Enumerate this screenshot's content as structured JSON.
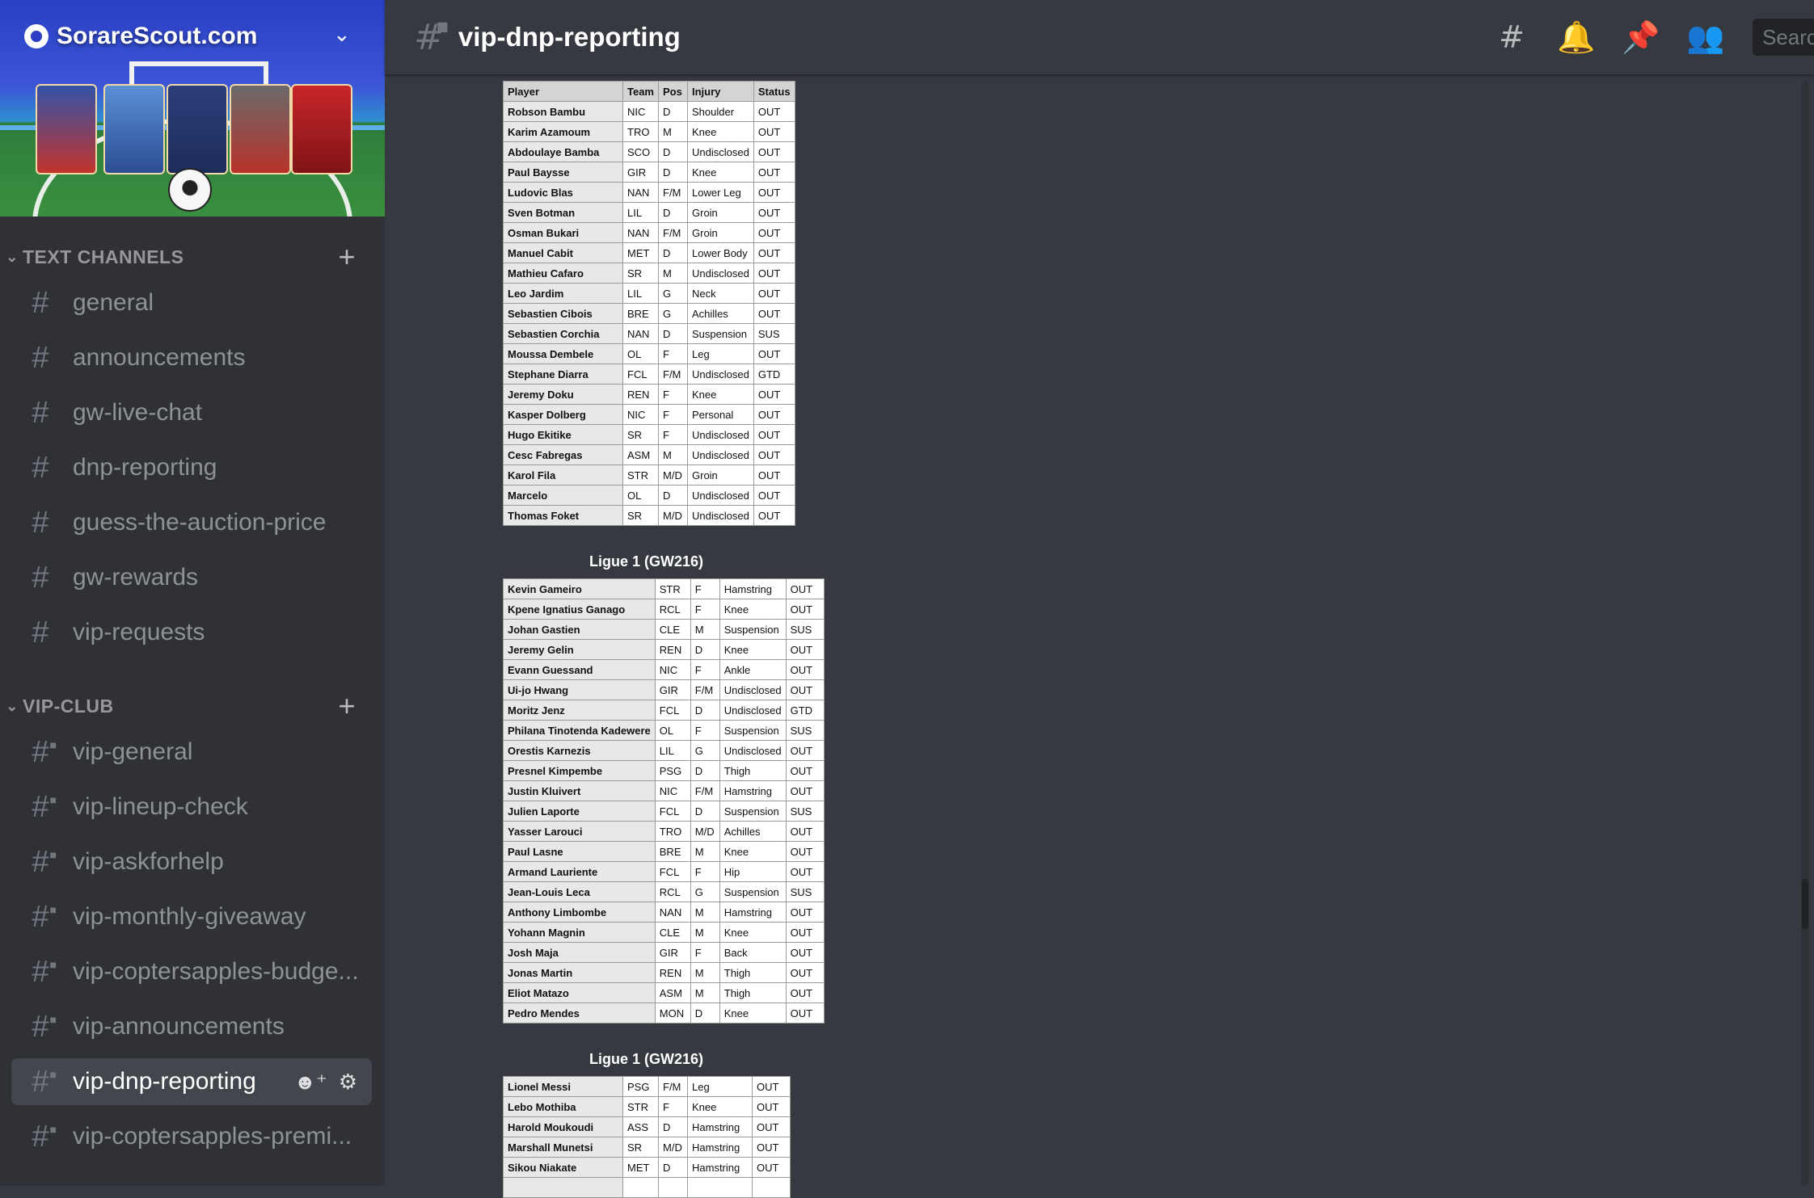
{
  "server": {
    "name": "SorareScout.com"
  },
  "categories": [
    {
      "label": "TEXT CHANNELS",
      "channels": [
        "general",
        "announcements",
        "gw-live-chat",
        "dnp-reporting",
        "guess-the-auction-price",
        "gw-rewards",
        "vip-requests"
      ]
    },
    {
      "label": "VIP-CLUB",
      "channels": [
        "vip-general",
        "vip-lineup-check",
        "vip-askforhelp",
        "vip-monthly-giveaway",
        "vip-coptersapples-budge...",
        "vip-announcements",
        "vip-dnp-reporting",
        "vip-coptersapples-premi..."
      ]
    }
  ],
  "header": {
    "channel_name": "vip-dnp-reporting",
    "search_placeholder": "Search"
  },
  "table_headers": [
    "Player",
    "Team",
    "Pos",
    "Injury",
    "Status"
  ],
  "tables": [
    {
      "title": "",
      "rows": [
        [
          "Robson Bambu",
          "NIC",
          "D",
          "Shoulder",
          "OUT"
        ],
        [
          "Karim Azamoum",
          "TRO",
          "M",
          "Knee",
          "OUT"
        ],
        [
          "Abdoulaye Bamba",
          "SCO",
          "D",
          "Undisclosed",
          "OUT"
        ],
        [
          "Paul Baysse",
          "GIR",
          "D",
          "Knee",
          "OUT"
        ],
        [
          "Ludovic Blas",
          "NAN",
          "F/M",
          "Lower Leg",
          "OUT"
        ],
        [
          "Sven Botman",
          "LIL",
          "D",
          "Groin",
          "OUT"
        ],
        [
          "Osman Bukari",
          "NAN",
          "F/M",
          "Groin",
          "OUT"
        ],
        [
          "Manuel Cabit",
          "MET",
          "D",
          "Lower Body",
          "OUT"
        ],
        [
          "Mathieu Cafaro",
          "SR",
          "M",
          "Undisclosed",
          "OUT"
        ],
        [
          "Leo Jardim",
          "LIL",
          "G",
          "Neck",
          "OUT"
        ],
        [
          "Sebastien Cibois",
          "BRE",
          "G",
          "Achilles",
          "OUT"
        ],
        [
          "Sebastien Corchia",
          "NAN",
          "D",
          "Suspension",
          "SUS"
        ],
        [
          "Moussa Dembele",
          "OL",
          "F",
          "Leg",
          "OUT"
        ],
        [
          "Stephane Diarra",
          "FCL",
          "F/M",
          "Undisclosed",
          "GTD"
        ],
        [
          "Jeremy Doku",
          "REN",
          "F",
          "Knee",
          "OUT"
        ],
        [
          "Kasper Dolberg",
          "NIC",
          "F",
          "Personal",
          "OUT"
        ],
        [
          "Hugo Ekitike",
          "SR",
          "F",
          "Undisclosed",
          "OUT"
        ],
        [
          "Cesc Fabregas",
          "ASM",
          "M",
          "Undisclosed",
          "OUT"
        ],
        [
          "Karol Fila",
          "STR",
          "M/D",
          "Groin",
          "OUT"
        ],
        [
          "Marcelo",
          "OL",
          "D",
          "Undisclosed",
          "OUT"
        ],
        [
          "Thomas Foket",
          "SR",
          "M/D",
          "Undisclosed",
          "OUT"
        ]
      ]
    },
    {
      "title": "Ligue 1 (GW216)",
      "rows": [
        [
          "Kevin Gameiro",
          "STR",
          "F",
          "Hamstring",
          "OUT"
        ],
        [
          "Kpene Ignatius Ganago",
          "RCL",
          "F",
          "Knee",
          "OUT"
        ],
        [
          "Johan Gastien",
          "CLE",
          "M",
          "Suspension",
          "SUS"
        ],
        [
          "Jeremy Gelin",
          "REN",
          "D",
          "Knee",
          "OUT"
        ],
        [
          "Evann Guessand",
          "NIC",
          "F",
          "Ankle",
          "OUT"
        ],
        [
          "Ui-jo Hwang",
          "GIR",
          "F/M",
          "Undisclosed",
          "OUT"
        ],
        [
          "Moritz Jenz",
          "FCL",
          "D",
          "Undisclosed",
          "GTD"
        ],
        [
          "Philana Tinotenda Kadewere",
          "OL",
          "F",
          "Suspension",
          "SUS"
        ],
        [
          "Orestis Karnezis",
          "LIL",
          "G",
          "Undisclosed",
          "OUT"
        ],
        [
          "Presnel Kimpembe",
          "PSG",
          "D",
          "Thigh",
          "OUT"
        ],
        [
          "Justin Kluivert",
          "NIC",
          "F/M",
          "Hamstring",
          "OUT"
        ],
        [
          "Julien Laporte",
          "FCL",
          "D",
          "Suspension",
          "SUS"
        ],
        [
          "Yasser Larouci",
          "TRO",
          "M/D",
          "Achilles",
          "OUT"
        ],
        [
          "Paul Lasne",
          "BRE",
          "M",
          "Knee",
          "OUT"
        ],
        [
          "Armand Lauriente",
          "FCL",
          "F",
          "Hip",
          "OUT"
        ],
        [
          "Jean-Louis Leca",
          "RCL",
          "G",
          "Suspension",
          "SUS"
        ],
        [
          "Anthony Limbombe",
          "NAN",
          "M",
          "Hamstring",
          "OUT"
        ],
        [
          "Yohann Magnin",
          "CLE",
          "M",
          "Knee",
          "OUT"
        ],
        [
          "Josh Maja",
          "GIR",
          "F",
          "Back",
          "OUT"
        ],
        [
          "Jonas Martin",
          "REN",
          "M",
          "Thigh",
          "OUT"
        ],
        [
          "Eliot Matazo",
          "ASM",
          "M",
          "Thigh",
          "OUT"
        ],
        [
          "Pedro Mendes",
          "MON",
          "D",
          "Knee",
          "OUT"
        ]
      ]
    },
    {
      "title": "Ligue 1 (GW216)",
      "rows": [
        [
          "Lionel Messi",
          "PSG",
          "F/M",
          "Leg",
          "OUT"
        ],
        [
          "Lebo Mothiba",
          "STR",
          "F",
          "Knee",
          "OUT"
        ],
        [
          "Harold Moukoudi",
          "ASS",
          "D",
          "Hamstring",
          "OUT"
        ],
        [
          "Marshall Munetsi",
          "SR",
          "M/D",
          "Hamstring",
          "OUT"
        ],
        [
          "Sikou Niakate",
          "MET",
          "D",
          "Hamstring",
          "OUT"
        ],
        [
          "",
          "",
          "",
          "",
          ""
        ]
      ]
    }
  ],
  "colors": {
    "sidebar_bg": "#2f3136",
    "chat_bg": "#36393f",
    "active_channel_bg": "#42464d",
    "muted_text": "#8e9297"
  },
  "icons": {
    "header": [
      "threads-icon",
      "bell-icon",
      "pin-icon",
      "members-icon"
    ],
    "active_channel": [
      "add-member-icon",
      "gear-icon"
    ]
  }
}
